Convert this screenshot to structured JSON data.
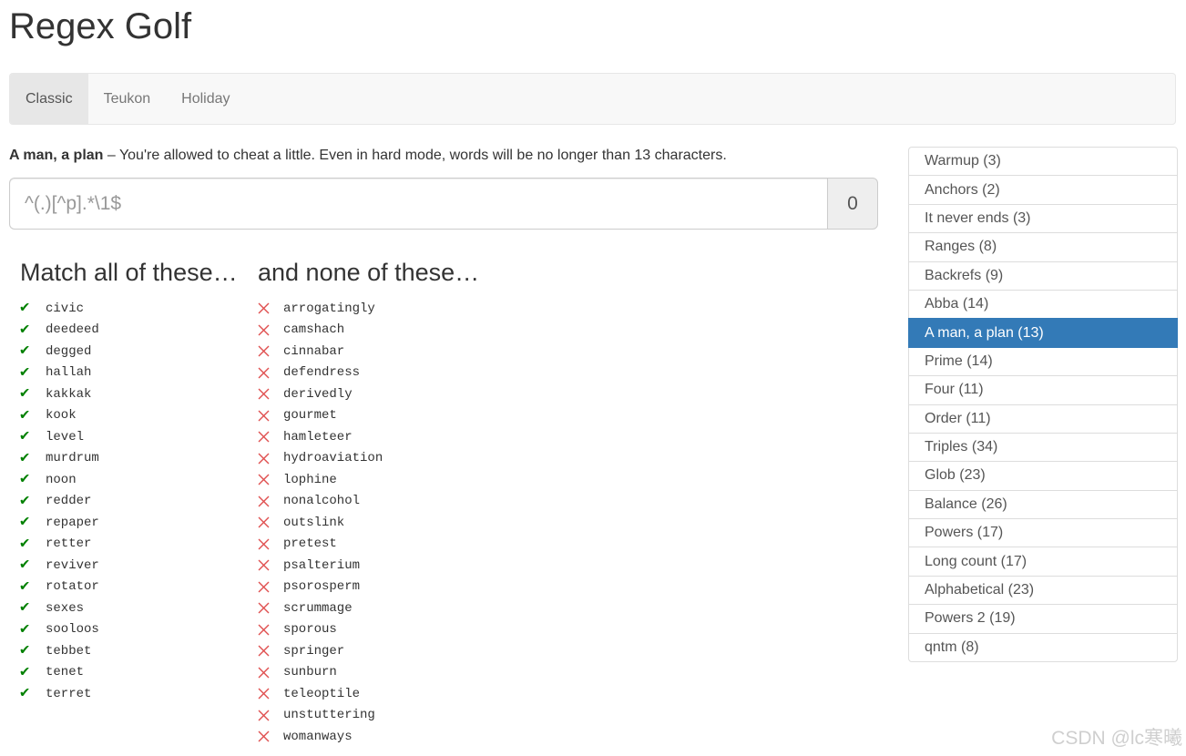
{
  "app": {
    "title": "Regex Golf"
  },
  "nav": {
    "tabs": [
      {
        "label": "Classic",
        "active": true
      },
      {
        "label": "Teukon",
        "active": false
      },
      {
        "label": "Holiday",
        "active": false
      }
    ]
  },
  "puzzle": {
    "name": "A man, a plan",
    "description": " – You're allowed to cheat a little. Even in hard mode, words will be no longer than 13 characters.",
    "input_placeholder": "^(.)[^p].*\\1$",
    "score": "0"
  },
  "match": {
    "heading": "Match all of these…",
    "icon": "check-icon",
    "color": "#008000",
    "words": [
      "civic",
      "deedeed",
      "degged",
      "hallah",
      "kakkak",
      "kook",
      "level",
      "murdrum",
      "noon",
      "redder",
      "repaper",
      "retter",
      "reviver",
      "rotator",
      "sexes",
      "sooloos",
      "tebbet",
      "tenet",
      "terret"
    ]
  },
  "nonmatch": {
    "heading": "and none of these…",
    "icon": "cross-icon",
    "color": "#e05050",
    "words": [
      "arrogatingly",
      "camshach",
      "cinnabar",
      "defendress",
      "derivedly",
      "gourmet",
      "hamleteer",
      "hydroaviation",
      "lophine",
      "nonalcohol",
      "outslink",
      "pretest",
      "psalterium",
      "psorosperm",
      "scrummage",
      "sporous",
      "springer",
      "sunburn",
      "teleoptile",
      "unstuttering",
      "womanways"
    ]
  },
  "levels": {
    "active_color": "#337ab7",
    "items": [
      {
        "label": "Warmup (3)",
        "active": false
      },
      {
        "label": "Anchors (2)",
        "active": false
      },
      {
        "label": "It never ends (3)",
        "active": false
      },
      {
        "label": "Ranges (8)",
        "active": false
      },
      {
        "label": "Backrefs (9)",
        "active": false
      },
      {
        "label": "Abba (14)",
        "active": false
      },
      {
        "label": "A man, a plan (13)",
        "active": true
      },
      {
        "label": "Prime (14)",
        "active": false
      },
      {
        "label": "Four (11)",
        "active": false
      },
      {
        "label": "Order (11)",
        "active": false
      },
      {
        "label": "Triples (34)",
        "active": false
      },
      {
        "label": "Glob (23)",
        "active": false
      },
      {
        "label": "Balance (26)",
        "active": false
      },
      {
        "label": "Powers (17)",
        "active": false
      },
      {
        "label": "Long count (17)",
        "active": false
      },
      {
        "label": "Alphabetical (23)",
        "active": false
      },
      {
        "label": "Powers 2 (19)",
        "active": false
      },
      {
        "label": "qntm (8)",
        "active": false
      }
    ]
  },
  "watermark": {
    "text": "CSDN @lc寒曦"
  }
}
